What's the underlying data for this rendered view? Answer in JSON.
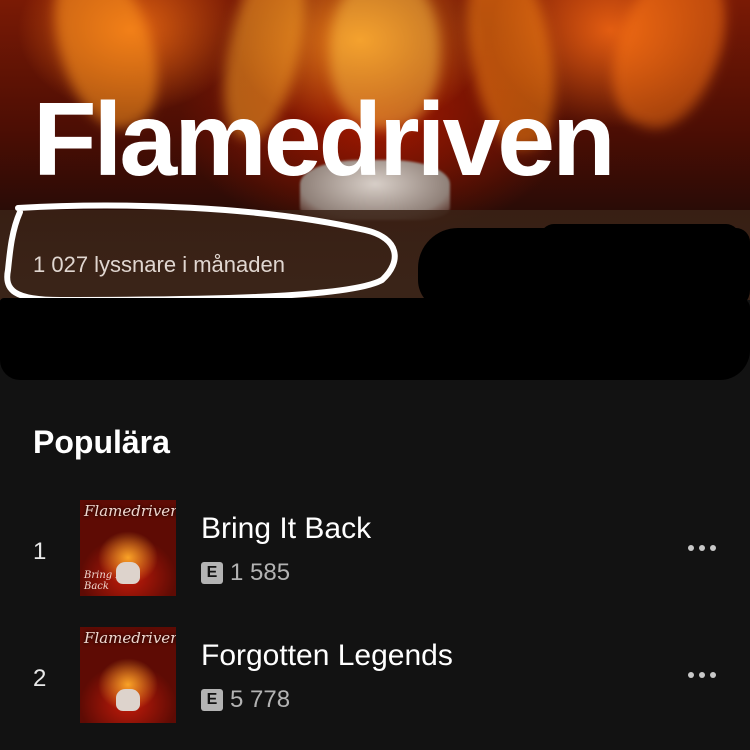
{
  "artist": {
    "name": "Flamedriven",
    "monthly_listeners": "1 027 lyssnare i månaden"
  },
  "popular": {
    "heading": "Populära",
    "tracks": [
      {
        "index": "1",
        "title": "Bring It Back",
        "explicit_label": "E",
        "plays": "1 585",
        "cover_logo": "Flamedriven",
        "cover_subtitle": "Bring It Back"
      },
      {
        "index": "2",
        "title": "Forgotten Legends",
        "explicit_label": "E",
        "plays": "5 778",
        "cover_logo": "Flamedriven",
        "cover_subtitle": ""
      }
    ]
  },
  "icons": {
    "more": "more-options-icon",
    "explicit": "explicit-badge-icon"
  },
  "colors": {
    "background": "#121212",
    "text_primary": "#ffffff",
    "text_secondary": "#b3b3b3",
    "annotation_stroke": "#ffffff",
    "redaction": "#000000"
  }
}
